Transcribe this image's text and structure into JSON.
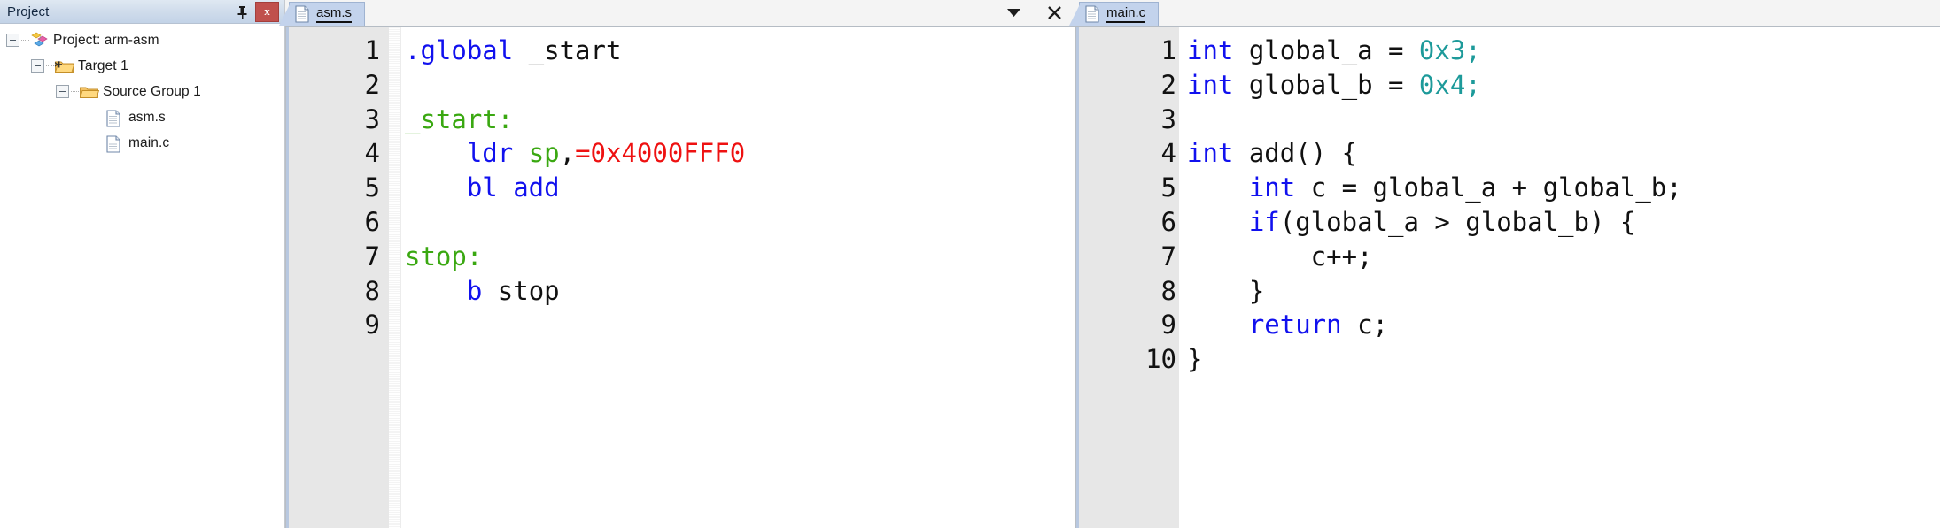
{
  "project_panel": {
    "title": "Project",
    "pin_icon": "pin-icon",
    "close_label": "x",
    "tree": [
      {
        "label": "Project: arm-asm",
        "depth": 0,
        "icon": "project-icon",
        "expander": "minus",
        "expandable": true
      },
      {
        "label": "Target 1",
        "depth": 1,
        "icon": "target-folder-icon",
        "expander": "minus",
        "expandable": true
      },
      {
        "label": "Source Group 1",
        "depth": 2,
        "icon": "folder-icon",
        "expander": "minus",
        "expandable": true
      },
      {
        "label": "asm.s",
        "depth": 3,
        "icon": "file-icon",
        "expander": "none",
        "expandable": false
      },
      {
        "label": "main.c",
        "depth": 3,
        "icon": "file-icon",
        "expander": "none",
        "expandable": false
      }
    ]
  },
  "editors": [
    {
      "id": "asm-editor",
      "tab": {
        "label": "asm.s",
        "icon": "file-icon",
        "active": true
      },
      "tools": {
        "dropdown": "chevron-down-icon",
        "close": "close-icon",
        "show": true
      },
      "line_numbers": [
        "1",
        "2",
        "3",
        "4",
        "5",
        "6",
        "7",
        "8",
        "9"
      ],
      "lines": [
        [
          {
            "t": ".global",
            "c": "kw"
          },
          {
            "t": " _start",
            "c": "pln"
          }
        ],
        [],
        [
          {
            "t": "_start:",
            "c": "lbl"
          }
        ],
        [
          {
            "t": "    ",
            "c": "pln"
          },
          {
            "t": "ldr",
            "c": "kw"
          },
          {
            "t": " ",
            "c": "pln"
          },
          {
            "t": "sp",
            "c": "reg"
          },
          {
            "t": ",",
            "c": "pln"
          },
          {
            "t": "=0x4000FFF0",
            "c": "num"
          }
        ],
        [
          {
            "t": "    ",
            "c": "pln"
          },
          {
            "t": "bl add",
            "c": "kw"
          }
        ],
        [],
        [
          {
            "t": "stop:",
            "c": "lbl"
          }
        ],
        [
          {
            "t": "    ",
            "c": "pln"
          },
          {
            "t": "b",
            "c": "kw"
          },
          {
            "t": " stop",
            "c": "pln"
          }
        ],
        []
      ]
    },
    {
      "id": "c-editor",
      "tab": {
        "label": "main.c",
        "icon": "file-icon",
        "active": true
      },
      "tools": {
        "dropdown": "chevron-down-icon",
        "close": "close-icon",
        "show": false
      },
      "line_numbers": [
        "1",
        "2",
        "3",
        "4",
        "5",
        "6",
        "7",
        "8",
        "9",
        "10"
      ],
      "lines": [
        [
          {
            "t": "int",
            "c": "kw"
          },
          {
            "t": " global_a = ",
            "c": "pln"
          },
          {
            "t": "0x3;",
            "c": "hex"
          }
        ],
        [
          {
            "t": "int",
            "c": "kw"
          },
          {
            "t": " global_b = ",
            "c": "pln"
          },
          {
            "t": "0x4;",
            "c": "hex"
          }
        ],
        [],
        [
          {
            "t": "int",
            "c": "kw"
          },
          {
            "t": " add() {",
            "c": "pln"
          }
        ],
        [
          {
            "t": "    ",
            "c": "pln"
          },
          {
            "t": "int",
            "c": "kw"
          },
          {
            "t": " c = global_a + global_b;",
            "c": "pln"
          }
        ],
        [
          {
            "t": "    ",
            "c": "pln"
          },
          {
            "t": "if",
            "c": "kw"
          },
          {
            "t": "(global_a > global_b) {",
            "c": "pln"
          }
        ],
        [
          {
            "t": "        c++;",
            "c": "pln"
          }
        ],
        [
          {
            "t": "    }",
            "c": "pln"
          }
        ],
        [
          {
            "t": "    ",
            "c": "pln"
          },
          {
            "t": "return",
            "c": "kw"
          },
          {
            "t": " c;",
            "c": "pln"
          }
        ],
        [
          {
            "t": "}",
            "c": "pln"
          }
        ]
      ]
    }
  ],
  "palette": {
    "keyword": "#1111ee",
    "label": "#3aa811",
    "number": "#ee1111",
    "register": "#3aa811",
    "hex": "#1d9a9a",
    "plain": "#111111",
    "gutter_bg": "#e7e7e7",
    "tab_active_bg": "#c3d3ec",
    "panel_header_bg": "#cedbeb",
    "close_button_bg": "#c0504d"
  }
}
